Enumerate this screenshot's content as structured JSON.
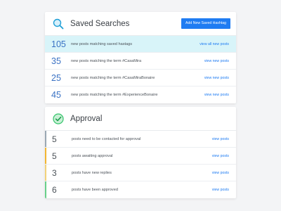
{
  "saved_searches": {
    "title": "Saved Searches",
    "add_button_label": "Add New Saved Hashtag",
    "rows": [
      {
        "count": "105",
        "text": "new posts matching saved hastags",
        "link": "view all new posts",
        "highlight": true
      },
      {
        "count": "35",
        "text": "new posts matching the term #CasaMira",
        "link": "view new posts"
      },
      {
        "count": "25",
        "text": "new posts matching the term #CasaMiraBonaire",
        "link": "view new posts"
      },
      {
        "count": "45",
        "text": "new posts matching the term #ExperienceBonaire",
        "link": "view new posts"
      }
    ]
  },
  "approval": {
    "title": "Approval",
    "rows": [
      {
        "count": "5",
        "text": "posts need to be contacted for approval",
        "link": "view posts",
        "accent": "#9aa7b3"
      },
      {
        "count": "5",
        "text": "posts awaiting approval",
        "link": "view posts",
        "accent": "#f2b632"
      },
      {
        "count": "3",
        "text": "posts have new replies",
        "link": "view posts",
        "accent": "#f2d27a"
      },
      {
        "count": "6",
        "text": "posts have been approved",
        "link": "view posts",
        "accent": "#68d08a"
      }
    ]
  },
  "colors": {
    "accent_blue": "#1f7cf2",
    "highlight_bg": "#d8f4f9",
    "check_green": "#35c46b"
  },
  "icons": {
    "saved_searches": "search-icon",
    "approval": "check-circle-icon"
  }
}
